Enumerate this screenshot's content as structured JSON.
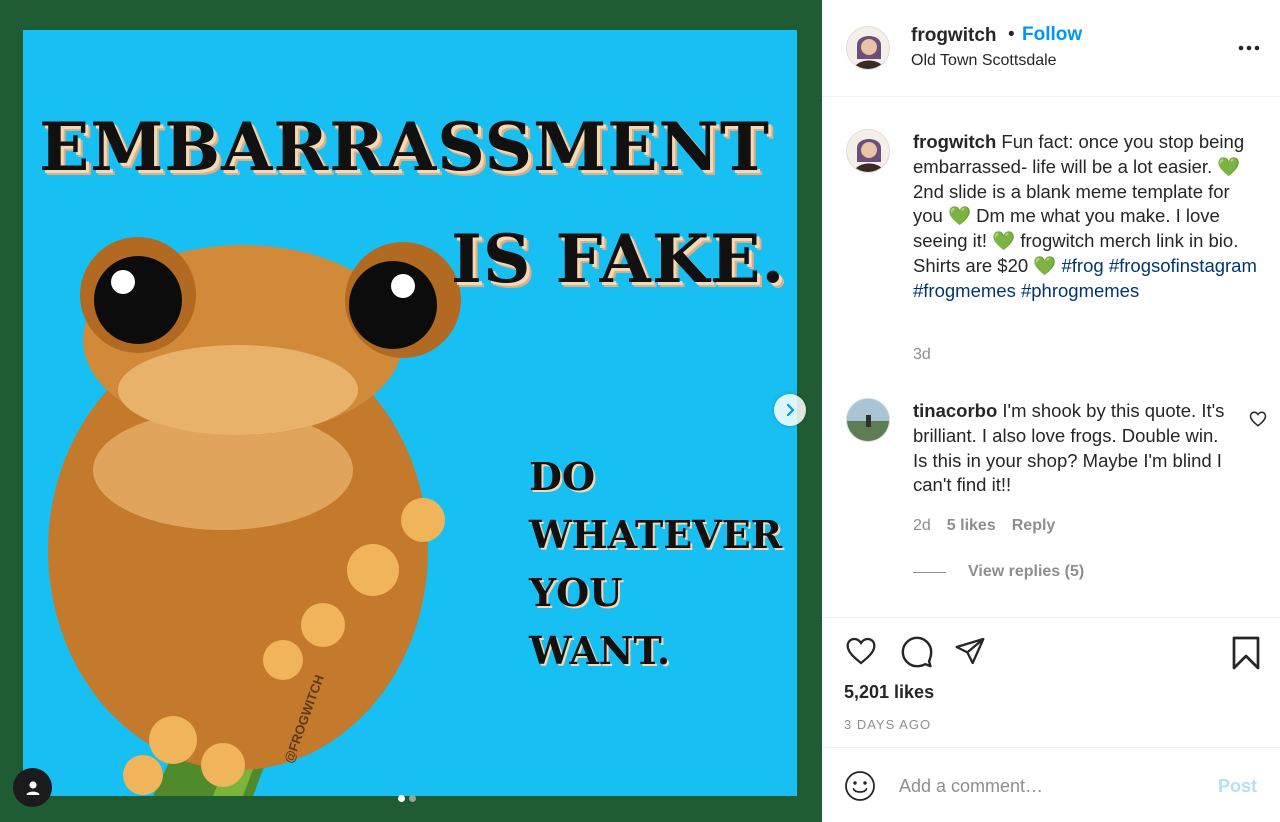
{
  "post": {
    "image_text": {
      "headline_line1": "EMBARRASSMENT",
      "headline_line2": "IS FAKE.",
      "sub_line1": "DO",
      "sub_line2": "WHATEVER",
      "sub_line3": "YOU",
      "sub_line4": "WANT.",
      "watermark": "@FROGWITCH"
    },
    "carousel": {
      "current": 1,
      "total": 2
    }
  },
  "header": {
    "username": "frogwitch",
    "separator": "•",
    "follow_label": "Follow",
    "location": "Old Town Scottsdale"
  },
  "caption": {
    "username": "frogwitch",
    "text": "Fun fact: once you stop being embarrassed- life will be a lot easier. 💚 2nd slide is a blank meme template for you 💚 Dm me what you make. I love seeing it! 💚 frogwitch merch link in bio. Shirts are $20 💚",
    "hashtags": [
      "#frog",
      "#frogsofinstagram",
      "#frogmemes",
      "#phrogmemes"
    ],
    "time": "3d"
  },
  "comments": [
    {
      "username": "tinacorbo",
      "text": "I'm shook by this quote. It's brilliant. I also love frogs. Double win. Is this in your shop? Maybe I'm blind I can't find it!!",
      "time": "2d",
      "likes": "5 likes",
      "reply_label": "Reply",
      "view_replies": "View replies (5)"
    }
  ],
  "engagement": {
    "likes": "5,201 likes",
    "posted": "3 DAYS AGO"
  },
  "add_comment": {
    "placeholder": "Add a comment…",
    "post_label": "Post"
  },
  "colors": {
    "frame": "#1f5c33",
    "image_bg": "#18bff2",
    "accent": "#0095f6",
    "hashtag": "#00376b",
    "post_disabled": "#b2dffc"
  }
}
